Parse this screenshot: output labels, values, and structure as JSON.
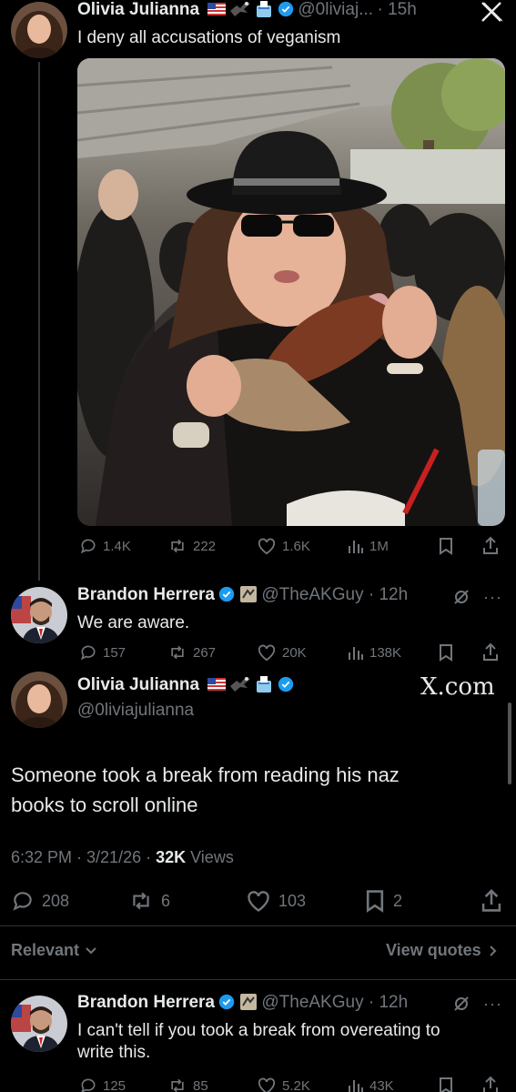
{
  "tweet1": {
    "name": "Olivia Julianna",
    "handle": "@0liviaj...",
    "time": "15h",
    "text": "I deny all accusations of veganism",
    "stats": {
      "replies": "1.4K",
      "reposts": "222",
      "likes": "1.6K",
      "views": "1M"
    }
  },
  "tweet2": {
    "name": "Brandon Herrera",
    "handle": "@TheAKGuy",
    "time": "12h",
    "text": "We are aware.",
    "stats": {
      "replies": "157",
      "reposts": "267",
      "likes": "20K",
      "views": "138K"
    }
  },
  "main": {
    "name": "Olivia Julianna",
    "handle": "@0liviajulianna",
    "watermark": "X.com",
    "text_line1": "Someone took a break from reading his naz",
    "text_line2": "books to scroll online",
    "timestamp": "6:32 PM · 3/21/26 · ",
    "views_count": "32K",
    "views_label": " Views",
    "stats": {
      "replies": "208",
      "reposts": "6",
      "likes": "103",
      "bookmarks": "2"
    }
  },
  "sort": {
    "relevant": "Relevant",
    "view_quotes": "View quotes"
  },
  "reply": {
    "name": "Brandon Herrera",
    "handle": "@TheAKGuy",
    "time": "12h",
    "text_line1": "I can't tell if you took a break from overeating to",
    "text_line2": "write this.",
    "stats": {
      "replies": "125",
      "reposts": "85",
      "likes": "5.2K",
      "views": "43K"
    }
  },
  "colors": {
    "accent": "#1d9bf0",
    "text": "#e7e9ea",
    "muted": "#71767b",
    "background": "#000000"
  }
}
